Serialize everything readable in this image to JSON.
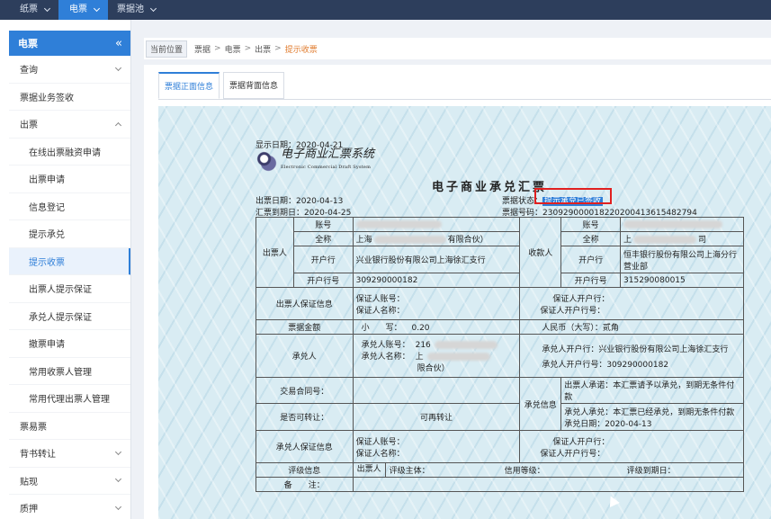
{
  "topnav": [
    {
      "label": "纸票",
      "active": false
    },
    {
      "label": "电票",
      "active": true
    },
    {
      "label": "票据池",
      "active": false
    }
  ],
  "sidebar": {
    "title": "电票",
    "collapse_icon": "«",
    "items": [
      {
        "label": "查询",
        "sub": false,
        "chev": "down"
      },
      {
        "label": "票据业务签收",
        "sub": false,
        "chev": ""
      },
      {
        "label": "出票",
        "sub": false,
        "chev": "up"
      },
      {
        "label": "在线出票融资申请",
        "sub": true,
        "chev": ""
      },
      {
        "label": "出票申请",
        "sub": true,
        "chev": ""
      },
      {
        "label": "信息登记",
        "sub": true,
        "chev": ""
      },
      {
        "label": "提示承兑",
        "sub": true,
        "chev": ""
      },
      {
        "label": "提示收票",
        "sub": true,
        "chev": "",
        "active": true
      },
      {
        "label": "出票人提示保证",
        "sub": true,
        "chev": ""
      },
      {
        "label": "承兑人提示保证",
        "sub": true,
        "chev": ""
      },
      {
        "label": "撤票申请",
        "sub": true,
        "chev": ""
      },
      {
        "label": "常用收票人管理",
        "sub": true,
        "chev": ""
      },
      {
        "label": "常用代理出票人管理",
        "sub": true,
        "chev": ""
      },
      {
        "label": "票易票",
        "sub": false,
        "chev": ""
      },
      {
        "label": "背书转让",
        "sub": false,
        "chev": "down"
      },
      {
        "label": "贴现",
        "sub": false,
        "chev": "down"
      },
      {
        "label": "质押",
        "sub": false,
        "chev": "down"
      }
    ]
  },
  "breadcrumb": {
    "current_label": "当前位置",
    "path": [
      "票据",
      "电票",
      "出票"
    ],
    "last": "提示收票"
  },
  "tabs": [
    {
      "label": "票据正面信息",
      "active": true
    },
    {
      "label": "票据背面信息",
      "active": false
    }
  ],
  "bill": {
    "display_date": "显示日期：2020-04-21",
    "logo_text": "电子商业汇票系统",
    "logo_sub": "Electronic Commercial Draft System",
    "title": "电子商业承兑汇票",
    "issue_date": "出票日期：2020-04-13",
    "due_date": "汇票到期日：2020-04-25",
    "status_label": "票据状态：",
    "status_value": "提示承兑已签收",
    "bill_no_label": "票据号码：",
    "bill_no": "230929000018220200413615482794",
    "drawer": {
      "label": "出票人",
      "account_label": "账号",
      "name_label": "全称",
      "name_value": "上海",
      "name_tail": "有限合伙）",
      "bank_label": "开户行",
      "bank_value": "兴业银行股份有限公司上海徐汇支行",
      "bank_no_label": "开户行号",
      "bank_no_value": "309290000182"
    },
    "payee": {
      "label": "收款人",
      "account_label": "账号",
      "name_label": "全称",
      "name_value": "上",
      "name_tail": "司",
      "bank_label": "开户行",
      "bank_value": "恒丰银行股份有限公司上海分行营业部",
      "bank_no_label": "开户行号",
      "bank_no_value": "315290080015"
    },
    "drawer_guarantee": {
      "label": "出票人保证信息",
      "acct": "保证人账号：",
      "name": "保证人名称：",
      "bank": "保证人开户行：",
      "bank_no": "保证人开户行号："
    },
    "amount": {
      "label": "票据金额",
      "small_label": "小　　写：",
      "small_value": "0.20",
      "big_label": "人民币（大写）：",
      "big_value": "贰角"
    },
    "acceptor": {
      "label": "承兑人",
      "acct_label": "承兑人账号：",
      "acct_value": "216",
      "name_label": "承兑人名称：",
      "name_value": "上",
      "name_tail": "限合伙）",
      "bank_label": "承兑人开户行：",
      "bank_value": "兴业银行股份有限公司上海徐汇支行",
      "bank_no_label": "承兑人开户行号：",
      "bank_no_value": "309290000182"
    },
    "contract_label": "交易合同号：",
    "accept_info": {
      "label": "承兑信息",
      "drawer_promise": "出票人承诺：本汇票请予以承兑，到期无条件付款",
      "acceptor_promise": "承兑人承兑：本汇票已经承兑，到期无条件付款",
      "accept_date": "承兑日期：2020-04-13"
    },
    "transferable_label": "是否可转让：",
    "transferable_value": "可再转让",
    "acceptor_guarantee": {
      "label": "承兑人保证信息",
      "acct": "保证人账号：",
      "name": "保证人名称：",
      "bank": "保证人开户行：",
      "bank_no": "保证人开户行号："
    },
    "rating": {
      "label": "评级信息",
      "drawer": "出票人",
      "subject": "评级主体：",
      "grade": "信用等级：",
      "due": "评级到期日："
    },
    "remark_label": "备　　注："
  }
}
